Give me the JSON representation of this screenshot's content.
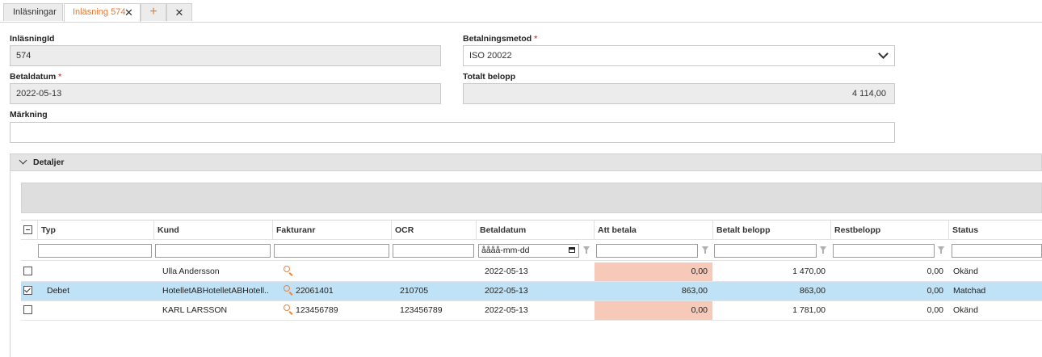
{
  "tabs": [
    {
      "label": "Inläsningar"
    },
    {
      "label": "Inläsning 574",
      "close": "✕"
    },
    {
      "label": "+"
    },
    {
      "label": "✕"
    }
  ],
  "form": {
    "inlasning_id": {
      "label": "InläsningId",
      "value": "574"
    },
    "betalningsmetod": {
      "label": "Betalningsmetod",
      "required": "*",
      "value": "ISO 20022"
    },
    "betaldatum": {
      "label": "Betaldatum",
      "required": "*",
      "value": "2022-05-13"
    },
    "totalt_belopp": {
      "label": "Totalt belopp",
      "value": "4 114,00"
    },
    "markning": {
      "label": "Märkning",
      "value": ""
    }
  },
  "details": {
    "label": "Detaljer"
  },
  "grid": {
    "columns": [
      "Typ",
      "Kund",
      "Fakturanr",
      "OCR",
      "Betaldatum",
      "Att betala",
      "Betalt belopp",
      "Restbelopp",
      "Status"
    ],
    "date_filter_placeholder": "åååå-mm-dd",
    "rows": [
      {
        "checked": false,
        "typ": "",
        "kund": "Ulla Andersson",
        "fakturanr": "",
        "ocr": "",
        "betaldatum": "2022-05-13",
        "att_betala": "0,00",
        "betalt_belopp": "1 470,00",
        "restbelopp": "0,00",
        "status": "Okänd"
      },
      {
        "checked": true,
        "typ": "Debet",
        "kund": "HotelletABHotelletABHotell...",
        "fakturanr": "22061401",
        "ocr": "210705",
        "betaldatum": "2022-05-13",
        "att_betala": "863,00",
        "betalt_belopp": "863,00",
        "restbelopp": "0,00",
        "status": "Matchad"
      },
      {
        "checked": false,
        "typ": "",
        "kund": "KARL LARSSON",
        "fakturanr": "123456789",
        "ocr": "123456789",
        "betaldatum": "2022-05-13",
        "att_betala": "0,00",
        "betalt_belopp": "1 781,00",
        "restbelopp": "0,00",
        "status": "Okänd"
      }
    ]
  },
  "colors": {
    "accent": "#e07b3a",
    "selected_row": "#bfe2f6",
    "highlight_cell": "#f7c9b9"
  },
  "icons": [
    "close-icon",
    "plus-icon",
    "chevron-down-icon",
    "magnifier-icon",
    "funnel-icon",
    "calendar-icon",
    "checkbox-icon"
  ]
}
